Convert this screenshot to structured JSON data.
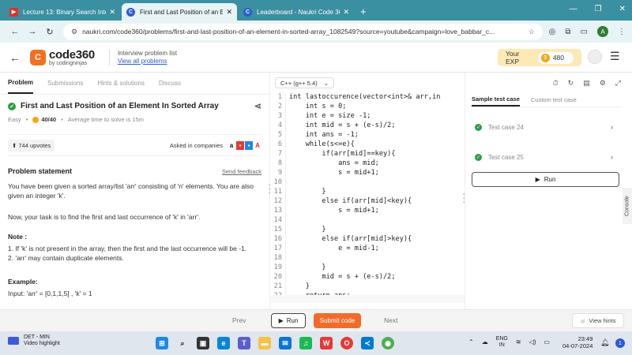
{
  "browser": {
    "tabs": [
      {
        "title": "Lecture 13: Binary Search Interv",
        "favicon": "youtube-icon",
        "active": false
      },
      {
        "title": "First and Last Position of an Ele",
        "favicon": "codingninjas-icon",
        "active": true
      },
      {
        "title": "Leaderboard - Naukri Code 360",
        "favicon": "codingninjas-icon",
        "active": false
      }
    ],
    "url": "naukri.com/code360/problems/first-and-last-position-of-an-element-in-sorted-array_1082549?source=youtube&campaign=love_babbar_c...",
    "profile_initial": "A"
  },
  "header": {
    "logo_main": "code360",
    "logo_sub": "by codingninjas",
    "interview_list_title": "Interview problem list",
    "interview_list_link": "View all problems",
    "exp_label": "Your EXP",
    "exp_value": "480"
  },
  "left": {
    "tabs": [
      "Problem",
      "Submissions",
      "Hints & solutions",
      "Discuss"
    ],
    "title": "First and Last Position of an Element In Sorted Array",
    "difficulty": "Easy",
    "points": "40/40",
    "avg_time": "Average time to solve is 15m",
    "upvotes": "744 upvotes",
    "asked_in": "Asked in companies",
    "statement_heading": "Problem statement",
    "send_feedback": "Send feedback",
    "para1": "You have been given a sorted array/list 'arr' consisting of 'n' elements. You are also given an integer 'k'.",
    "para2": "Now, your task is to find the first and last occurrence of 'k' in 'arr'.",
    "note_heading": "Note :",
    "note1": "1. If 'k' is not present in the array, then the first and the last occurrence will be -1.",
    "note2": "2. 'arr' may contain duplicate elements.",
    "example_heading": "Example:",
    "example_input": "Input: 'arr' = [0,1,1,5] , 'k' = 1"
  },
  "editor": {
    "language": "C++ (g++ 5.4)",
    "lines": [
      {
        "n": "1",
        "code": "int lastoccurence(vector<int>& arr,in"
      },
      {
        "n": "2",
        "code": "    int s = 0;"
      },
      {
        "n": "3",
        "code": "    int e = size -1;"
      },
      {
        "n": "4",
        "code": "    int mid = s + (e-s)/2;"
      },
      {
        "n": "5",
        "code": "    int ans = -1;"
      },
      {
        "n": "6",
        "code": "    while(s<=e){"
      },
      {
        "n": "7",
        "code": "        if(arr[mid]==key){"
      },
      {
        "n": "8",
        "code": "            ans = mid;"
      },
      {
        "n": "9",
        "code": "            s = mid+1;"
      },
      {
        "n": "10",
        "code": ""
      },
      {
        "n": "11",
        "code": "        }"
      },
      {
        "n": "12",
        "code": "        else if(arr[mid]<key){"
      },
      {
        "n": "13",
        "code": "            s = mid+1;"
      },
      {
        "n": "14",
        "code": ""
      },
      {
        "n": "15",
        "code": "        }"
      },
      {
        "n": "16",
        "code": "        else if(arr[mid]>key){"
      },
      {
        "n": "17",
        "code": "            e = mid-1;"
      },
      {
        "n": "18",
        "code": ""
      },
      {
        "n": "19",
        "code": "        }"
      },
      {
        "n": "20",
        "code": "        mid = s + (e-s)/2;"
      },
      {
        "n": "21",
        "code": "    }"
      },
      {
        "n": "22",
        "code": "    return ans;"
      }
    ]
  },
  "right": {
    "tabs": [
      "Sample test case",
      "Custom test case"
    ],
    "test_cases": [
      "Test case 24",
      "Test case 25"
    ],
    "run_label": "Run",
    "console_label": "Console"
  },
  "bottom": {
    "prev": "Prev",
    "run": "Run",
    "submit": "Submit code",
    "next": "Next",
    "view_hints": "View hints"
  },
  "taskbar": {
    "weather_title": "DET - MIN",
    "weather_sub": "Video highlight",
    "lang_top": "ENG",
    "lang_bottom": "IN",
    "time": "23:49",
    "date": "04-07-2024",
    "notif_count": "1"
  },
  "colors": {
    "accent": "#f26b2a",
    "tabstrip": "#3a8fa0",
    "success": "#2e9e47"
  }
}
